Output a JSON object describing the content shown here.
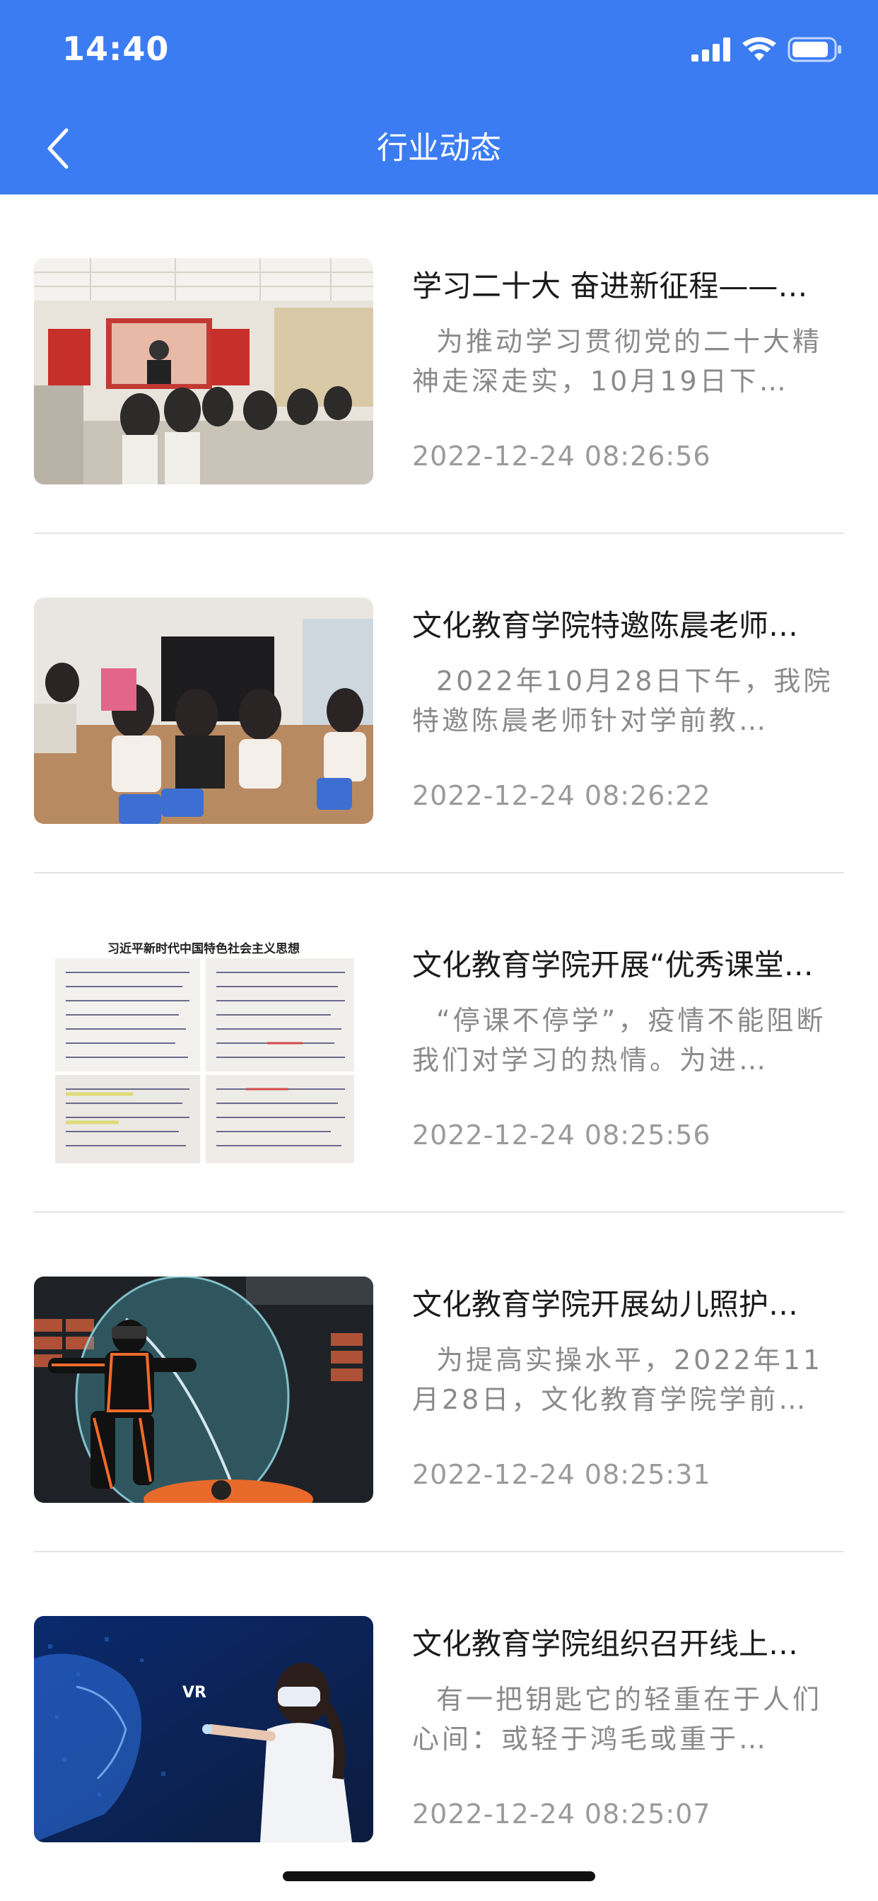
{
  "status_bar": {
    "time": "14:40"
  },
  "nav": {
    "title": "行业动态"
  },
  "colors": {
    "header_bg": "#3b7cf2",
    "title_text": "#1a1a1a",
    "summary_text": "#8a8a8a"
  },
  "articles": [
    {
      "title": "学习二十大 奋进新征程——…",
      "summary": "为推动学习贯彻党的二十大精神走深走实，10月19日下…",
      "time": "2022-12-24 08:26:56"
    },
    {
      "title": "文化教育学院特邀陈晨老师…",
      "summary": "2022年10月28日下午，我院特邀陈晨老师针对学前教…",
      "time": "2022-12-24 08:26:22"
    },
    {
      "title": "文化教育学院开展“优秀课堂…",
      "summary": "“停课不停学”，疫情不能阻断我们对学习的热情。为进…",
      "time": "2022-12-24 08:25:56"
    },
    {
      "title": "文化教育学院开展幼儿照护…",
      "summary": "为提高实操水平，2022年11月28日，文化教育学院学前…",
      "time": "2022-12-24 08:25:31"
    },
    {
      "title": "文化教育学院组织召开线上…",
      "summary": "有一把钥匙它的轻重在于人们心间：或轻于鸿毛或重于…",
      "time": "2022-12-24 08:25:07"
    }
  ],
  "thumbnail_text": {
    "notebook_banner": "习近平新时代中国特色社会主义思想",
    "vr_label": "VR"
  }
}
